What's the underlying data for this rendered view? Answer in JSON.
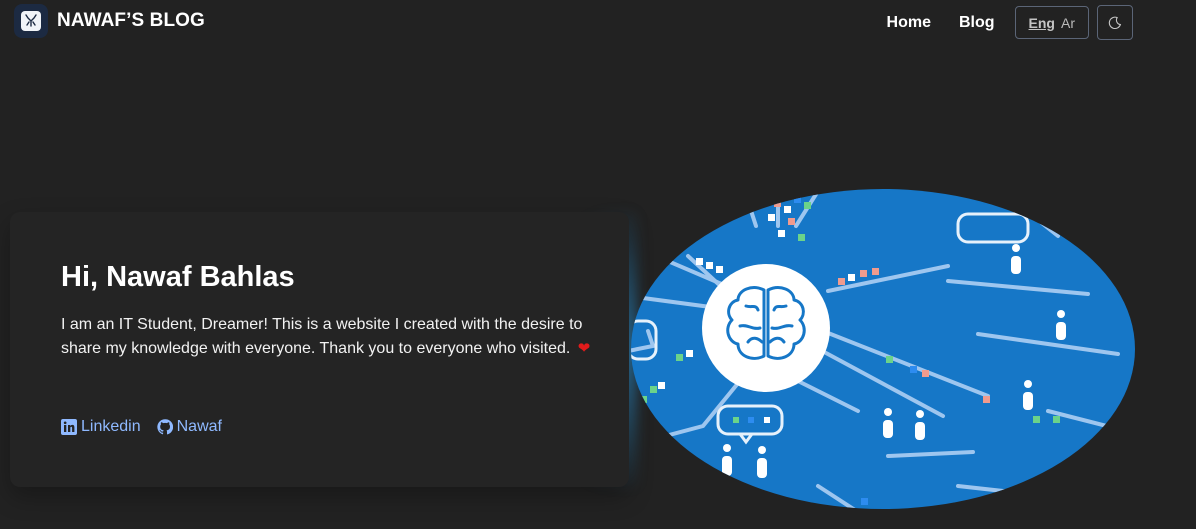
{
  "header": {
    "brand_title": "NAWAF’S BLOG",
    "logo_icon": "deer-logo-icon",
    "nav": [
      {
        "label": "Home"
      },
      {
        "label": "Blog"
      }
    ],
    "language": {
      "active": "Eng",
      "other": "Ar"
    },
    "theme_toggle_icon": "moon-icon"
  },
  "hero": {
    "title": "Hi, Nawaf Bahlas",
    "intro": "I am an IT Student, Dreamer! This is a website I created with the desire to share my knowledge with everyone. Thank you to everyone who visited.",
    "heart": "❤",
    "links": [
      {
        "label": "Linkedin",
        "icon": "linkedin-icon"
      },
      {
        "label": "Nawaf",
        "icon": "github-icon"
      }
    ],
    "illustration": "brain-network-illustration",
    "colors": {
      "background": "#222222",
      "illustration_blue": "#1677c7",
      "link": "#8fb9ff"
    }
  }
}
